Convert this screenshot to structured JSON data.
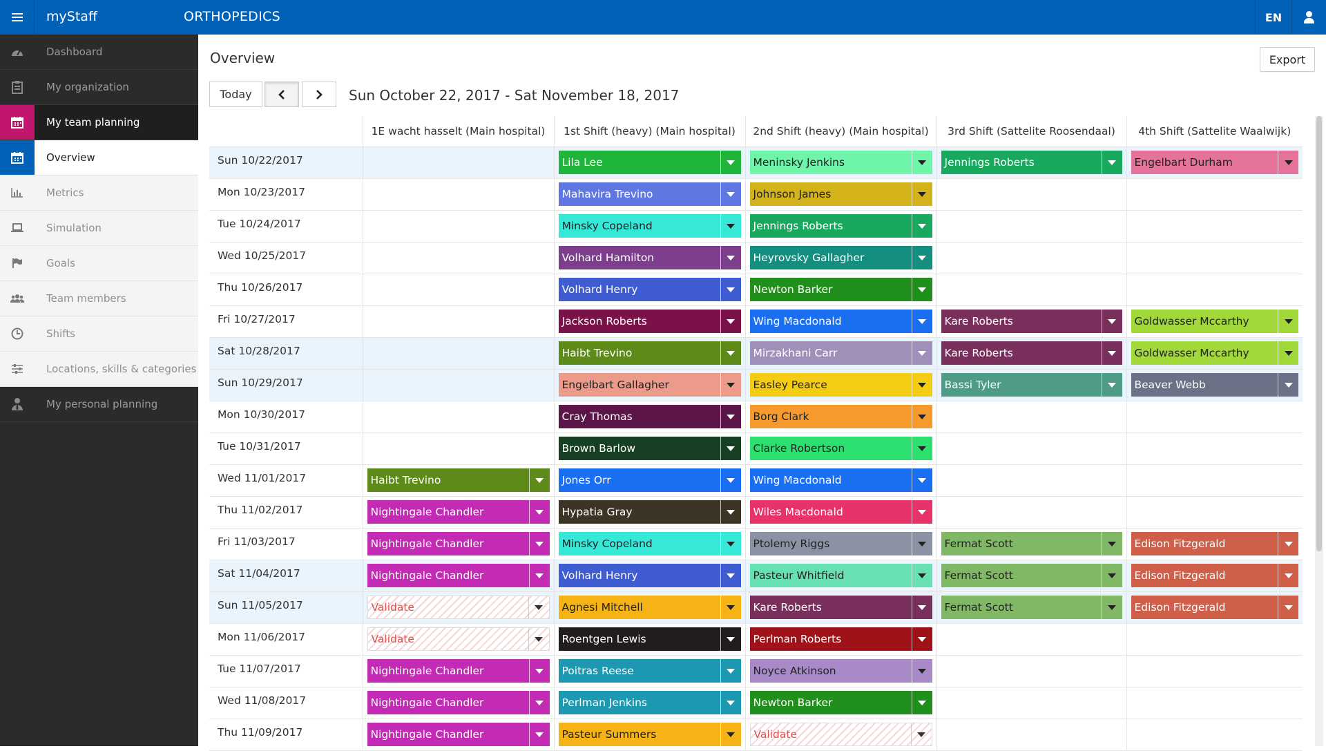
{
  "topbar": {
    "brand": "myStaff",
    "department": "ORTHOPEDICS",
    "language": "EN"
  },
  "sidebar": {
    "items": [
      {
        "label": "Dashboard",
        "icon": "dashboard-icon"
      },
      {
        "label": "My organization",
        "icon": "organization-icon"
      },
      {
        "label": "My team planning",
        "icon": "calendar-icon",
        "state": "parent-active"
      }
    ],
    "subitems": [
      {
        "label": "Overview",
        "icon": "calendar-icon",
        "state": "active"
      },
      {
        "label": "Metrics",
        "icon": "bar-chart-icon"
      },
      {
        "label": "Simulation",
        "icon": "laptop-icon"
      },
      {
        "label": "Goals",
        "icon": "flag-icon"
      },
      {
        "label": "Team members",
        "icon": "users-icon"
      },
      {
        "label": "Shifts",
        "icon": "clock-icon"
      },
      {
        "label": "Locations, skills & categories",
        "icon": "sliders-icon"
      }
    ],
    "bottom_items": [
      {
        "label": "My personal planning",
        "icon": "user-tie-icon"
      }
    ]
  },
  "main": {
    "title": "Overview",
    "export_label": "Export",
    "today_label": "Today",
    "date_range": "Sun October 22, 2017 - Sat November 18, 2017",
    "columns": [
      "1E wacht hasselt (Main hospital)",
      "1st Shift (heavy) (Main hospital)",
      "2nd Shift (heavy) (Main hospital)",
      "3rd Shift (Sattelite Roosendaal)",
      "4th Shift (Sattelite Waalwijk)"
    ],
    "rows": [
      {
        "date": "Sun 10/22/2017",
        "weekend": true,
        "cells": [
          null,
          {
            "name": "Lila Lee",
            "color": "#1eb53a"
          },
          {
            "name": "Meninsky Jenkins",
            "color": "#6ef5a9",
            "dark": true
          },
          {
            "name": "Jennings Roberts",
            "color": "#18a85e"
          },
          {
            "name": "Engelbart Durham",
            "color": "#e57399",
            "dark": true
          }
        ]
      },
      {
        "date": "Mon 10/23/2017",
        "cells": [
          null,
          {
            "name": "Mahavira Trevino",
            "color": "#5f77e0"
          },
          {
            "name": "Johnson James",
            "color": "#d4b21a",
            "dark": true
          },
          null,
          null
        ]
      },
      {
        "date": "Tue 10/24/2017",
        "cells": [
          null,
          {
            "name": "Minsky Copeland",
            "color": "#36e8d8",
            "dark": true
          },
          {
            "name": "Jennings Roberts",
            "color": "#18a85e"
          },
          null,
          null
        ]
      },
      {
        "date": "Wed 10/25/2017",
        "cells": [
          null,
          {
            "name": "Volhard Hamilton",
            "color": "#7d3f8c"
          },
          {
            "name": "Heyrovsky Gallagher",
            "color": "#148f7f"
          },
          null,
          null
        ]
      },
      {
        "date": "Thu 10/26/2017",
        "cells": [
          null,
          {
            "name": "Volhard Henry",
            "color": "#3f5cd1"
          },
          {
            "name": "Newton Barker",
            "color": "#218f1c"
          },
          null,
          null
        ]
      },
      {
        "date": "Fri 10/27/2017",
        "cells": [
          null,
          {
            "name": "Jackson Roberts",
            "color": "#7a1148"
          },
          {
            "name": "Wing Macdonald",
            "color": "#1a6ef0"
          },
          {
            "name": "Kare Roberts",
            "color": "#782f5c"
          },
          {
            "name": "Goldwasser Mccarthy",
            "color": "#a2d93a",
            "dark": true
          }
        ]
      },
      {
        "date": "Sat 10/28/2017",
        "weekend": true,
        "cells": [
          null,
          {
            "name": "Haibt Trevino",
            "color": "#5e8a1a"
          },
          {
            "name": "Mirzakhani Carr",
            "color": "#a08fb8"
          },
          {
            "name": "Kare Roberts",
            "color": "#782f5c"
          },
          {
            "name": "Goldwasser Mccarthy",
            "color": "#a2d93a",
            "dark": true
          }
        ]
      },
      {
        "date": "Sun 10/29/2017",
        "weekend": true,
        "cells": [
          null,
          {
            "name": "Engelbart Gallagher",
            "color": "#ec9a8a",
            "dark": true
          },
          {
            "name": "Easley Pearce",
            "color": "#f5cc14",
            "dark": true
          },
          {
            "name": "Bassi Tyler",
            "color": "#4f9c86"
          },
          {
            "name": "Beaver Webb",
            "color": "#6b7186"
          }
        ]
      },
      {
        "date": "Mon 10/30/2017",
        "cells": [
          null,
          {
            "name": "Cray Thomas",
            "color": "#5c1547"
          },
          {
            "name": "Borg Clark",
            "color": "#f79a2e",
            "dark": true
          },
          null,
          null
        ]
      },
      {
        "date": "Tue 10/31/2017",
        "cells": [
          null,
          {
            "name": "Brown Barlow",
            "color": "#173f24"
          },
          {
            "name": "Clarke Robertson",
            "color": "#2ee070",
            "dark": true
          },
          null,
          null
        ]
      },
      {
        "date": "Wed 11/01/2017",
        "cells": [
          {
            "name": "Haibt Trevino",
            "color": "#5e8a1a"
          },
          {
            "name": "Jones Orr",
            "color": "#1a6ef0"
          },
          {
            "name": "Wing Macdonald",
            "color": "#1a6ef0"
          },
          null,
          null
        ]
      },
      {
        "date": "Thu 11/02/2017",
        "cells": [
          {
            "name": "Nightingale Chandler",
            "color": "#c42bb5"
          },
          {
            "name": "Hypatia Gray",
            "color": "#3c3526"
          },
          {
            "name": "Wiles Macdonald",
            "color": "#e8336a"
          },
          null,
          null
        ]
      },
      {
        "date": "Fri 11/03/2017",
        "cells": [
          {
            "name": "Nightingale Chandler",
            "color": "#c42bb5"
          },
          {
            "name": "Minsky Copeland",
            "color": "#36e8d8",
            "dark": true
          },
          {
            "name": "Ptolemy Riggs",
            "color": "#8a92a3",
            "dark": true
          },
          {
            "name": "Fermat Scott",
            "color": "#80b865",
            "dark": true
          },
          {
            "name": "Edison Fitzgerald",
            "color": "#d05f4a"
          }
        ]
      },
      {
        "date": "Sat 11/04/2017",
        "weekend": true,
        "cells": [
          {
            "name": "Nightingale Chandler",
            "color": "#c42bb5"
          },
          {
            "name": "Volhard Henry",
            "color": "#3f5cd1"
          },
          {
            "name": "Pasteur Whitfield",
            "color": "#67e0b4",
            "dark": true
          },
          {
            "name": "Fermat Scott",
            "color": "#80b865",
            "dark": true
          },
          {
            "name": "Edison Fitzgerald",
            "color": "#d05f4a"
          }
        ]
      },
      {
        "date": "Sun 11/05/2017",
        "weekend": true,
        "cells": [
          {
            "name": "Validate",
            "validate": true
          },
          {
            "name": "Agnesi Mitchell",
            "color": "#f5b316",
            "dark": true
          },
          {
            "name": "Kare Roberts",
            "color": "#782f5c"
          },
          {
            "name": "Fermat Scott",
            "color": "#80b865",
            "dark": true
          },
          {
            "name": "Edison Fitzgerald",
            "color": "#d05f4a"
          }
        ]
      },
      {
        "date": "Mon 11/06/2017",
        "cells": [
          {
            "name": "Validate",
            "validate": true
          },
          {
            "name": "Roentgen Lewis",
            "color": "#221d1d"
          },
          {
            "name": "Perlman Roberts",
            "color": "#9e1218"
          },
          null,
          null
        ]
      },
      {
        "date": "Tue 11/07/2017",
        "cells": [
          {
            "name": "Nightingale Chandler",
            "color": "#c42bb5"
          },
          {
            "name": "Poitras Reese",
            "color": "#1c99b0"
          },
          {
            "name": "Noyce Atkinson",
            "color": "#a88ac9",
            "dark": true
          },
          null,
          null
        ]
      },
      {
        "date": "Wed 11/08/2017",
        "cells": [
          {
            "name": "Nightingale Chandler",
            "color": "#c42bb5"
          },
          {
            "name": "Perlman Jenkins",
            "color": "#1c99b0"
          },
          {
            "name": "Newton Barker",
            "color": "#218f1c"
          },
          null,
          null
        ]
      },
      {
        "date": "Thu 11/09/2017",
        "cells": [
          {
            "name": "Nightingale Chandler",
            "color": "#c42bb5"
          },
          {
            "name": "Pasteur Summers",
            "color": "#f5b316",
            "dark": true
          },
          {
            "name": "Validate",
            "validate": true
          },
          null,
          null
        ]
      }
    ]
  }
}
